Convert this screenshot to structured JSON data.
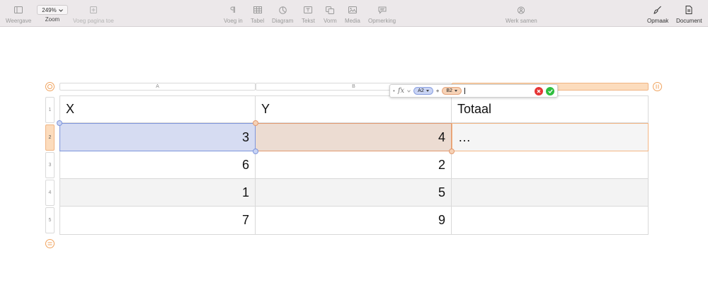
{
  "toolbar": {
    "view_label": "Weergave",
    "zoom_value": "249%",
    "zoom_label": "Zoom",
    "add_page_label": "Voeg pagina toe",
    "insert_label": "Voeg in",
    "table_label": "Tabel",
    "chart_label": "Diagram",
    "text_label": "Tekst",
    "shape_label": "Vorm",
    "media_label": "Media",
    "comment_label": "Opmerking",
    "collaborate_label": "Werk samen",
    "format_label": "Opmaak",
    "document_label": "Document"
  },
  "table": {
    "columns": [
      "A",
      "B",
      "C"
    ],
    "rows": [
      "1",
      "2",
      "3",
      "4",
      "5"
    ],
    "header": [
      "X",
      "Y",
      "Totaal"
    ],
    "data": [
      [
        "3",
        "4",
        "…"
      ],
      [
        "6",
        "2",
        ""
      ],
      [
        "1",
        "5",
        ""
      ],
      [
        "7",
        "9",
        ""
      ]
    ]
  },
  "formula": {
    "fx": "fx",
    "token1": "A2",
    "operator": "+",
    "token2": "B2"
  },
  "colors": {
    "token1_bg": "#c9d4f4",
    "token2_bg": "#f6d2b6",
    "selected_a": "#d6dcf2",
    "selected_b": "#ecdcd2",
    "accent": "#f0a35e"
  }
}
